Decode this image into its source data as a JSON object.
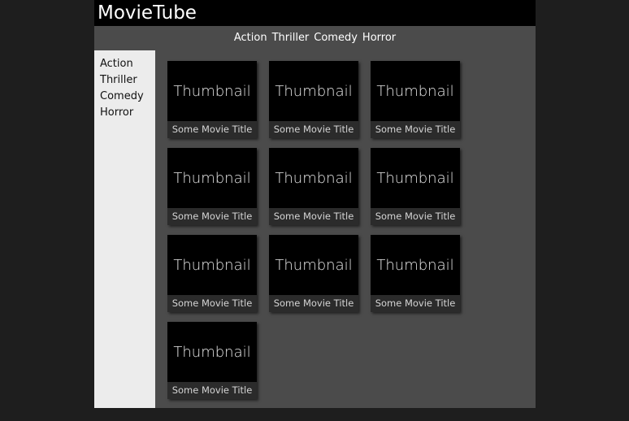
{
  "app": {
    "title": "MovieTube"
  },
  "top_nav": {
    "items": [
      {
        "label": "Action"
      },
      {
        "label": "Thriller"
      },
      {
        "label": "Comedy"
      },
      {
        "label": "Horror"
      }
    ]
  },
  "sidebar": {
    "items": [
      {
        "label": "Action"
      },
      {
        "label": "Thriller"
      },
      {
        "label": "Comedy"
      },
      {
        "label": "Horror"
      }
    ]
  },
  "movies": [
    {
      "thumbnail": "Thumbnail",
      "title": "Some Movie Title"
    },
    {
      "thumbnail": "Thumbnail",
      "title": "Some Movie Title"
    },
    {
      "thumbnail": "Thumbnail",
      "title": "Some Movie Title"
    },
    {
      "thumbnail": "Thumbnail",
      "title": "Some Movie Title"
    },
    {
      "thumbnail": "Thumbnail",
      "title": "Some Movie Title"
    },
    {
      "thumbnail": "Thumbnail",
      "title": "Some Movie Title"
    },
    {
      "thumbnail": "Thumbnail",
      "title": "Some Movie Title"
    },
    {
      "thumbnail": "Thumbnail",
      "title": "Some Movie Title"
    },
    {
      "thumbnail": "Thumbnail",
      "title": "Some Movie Title"
    },
    {
      "thumbnail": "Thumbnail",
      "title": "Some Movie Title"
    }
  ],
  "colors": {
    "page_background": "#1e1e1e",
    "app_background": "#4b4b4b",
    "header_background": "#000000",
    "sidebar_background": "#ececec",
    "card_background": "#000000",
    "caption_background": "#2b2b2b"
  }
}
